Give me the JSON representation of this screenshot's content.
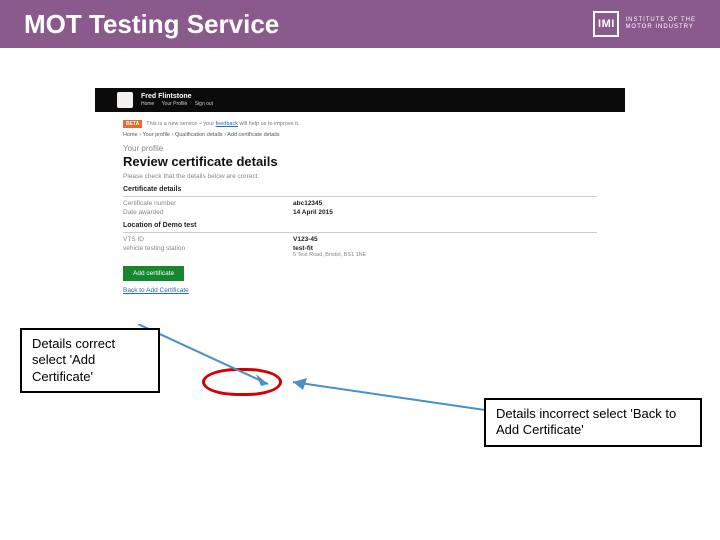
{
  "header": {
    "title": "MOT Testing Service",
    "logo_abbrev": "IMI",
    "logo_line1": "INSTITUTE OF THE",
    "logo_line2": "MOTOR INDUSTRY"
  },
  "callouts": {
    "correct": "Details correct select 'Add Certificate'",
    "incorrect": "Details incorrect select 'Back to Add Certificate'"
  },
  "screenshot": {
    "user_name": "Fred Flintstone",
    "nav_home": "Home",
    "nav_profile": "Your Profile",
    "nav_signout": "Sign out",
    "beta_label": "BETA",
    "beta_text_pre": "This is a new service – your ",
    "beta_link": "feedback",
    "beta_text_post": " will help us to improve it.",
    "breadcrumb": "Home › Your profile › Qualification details › Add certificate details",
    "profile_label": "Your profile",
    "review_heading": "Review certificate details",
    "desc": "Please check that the details below are correct.",
    "section_cert": "Certificate details",
    "cert_num_label": "Certificate number",
    "cert_num_value": "abc12345",
    "date_label": "Date awarded",
    "date_value": "14 April 2015",
    "section_loc": "Location of Demo test",
    "vts_id_label": "VTS ID",
    "vts_id_value": "V123-45",
    "station_label": "vehicle testing station",
    "station_name": "test-fit",
    "station_addr": "5 Test Road, Bristol, BS1 1NE",
    "add_button": "Add certificate",
    "back_link": "Back to Add Certificate"
  }
}
